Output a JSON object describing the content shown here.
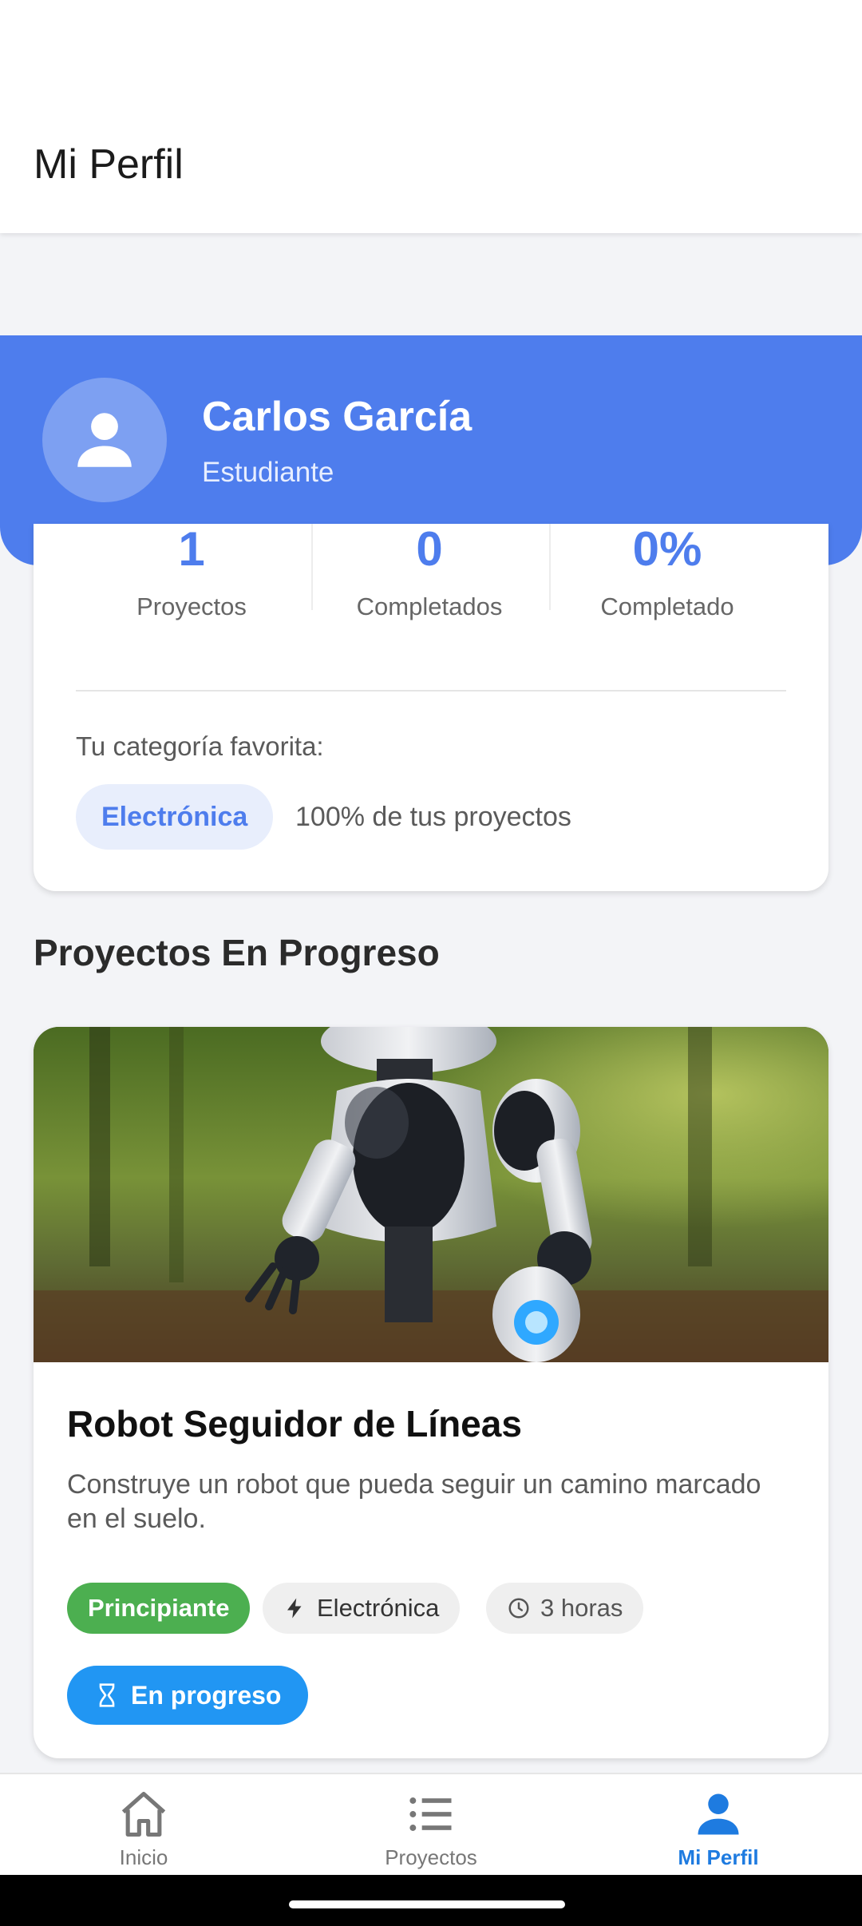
{
  "app_bar": {
    "title": "Mi Perfil"
  },
  "profile": {
    "name": "Carlos García",
    "role": "Estudiante"
  },
  "stats": [
    {
      "value": "1",
      "label": "Proyectos"
    },
    {
      "value": "0",
      "label": "Completados"
    },
    {
      "value": "0%",
      "label": "Completado"
    }
  ],
  "favorite": {
    "label": "Tu categoría favorita:",
    "category": "Electrónica",
    "share_text": "100% de tus proyectos"
  },
  "section": {
    "title": "Proyectos En Progreso"
  },
  "project": {
    "title": "Robot Seguidor de Líneas",
    "description": "Construye un robot que pueda seguir un camino marcado en el suelo.",
    "level": "Principiante",
    "category": "Electrónica",
    "duration": "3 horas",
    "status": "En progreso",
    "image_icon": "robot-photo"
  },
  "nav": {
    "items": [
      {
        "label": "Inicio",
        "icon": "home-icon"
      },
      {
        "label": "Proyectos",
        "icon": "list-icon"
      },
      {
        "label": "Mi Perfil",
        "icon": "person-icon",
        "active": true
      }
    ]
  },
  "colors": {
    "primary": "#4e7ded",
    "nav_active": "#1e7be0",
    "level_green": "#4caf50",
    "status_blue": "#2196f3"
  }
}
